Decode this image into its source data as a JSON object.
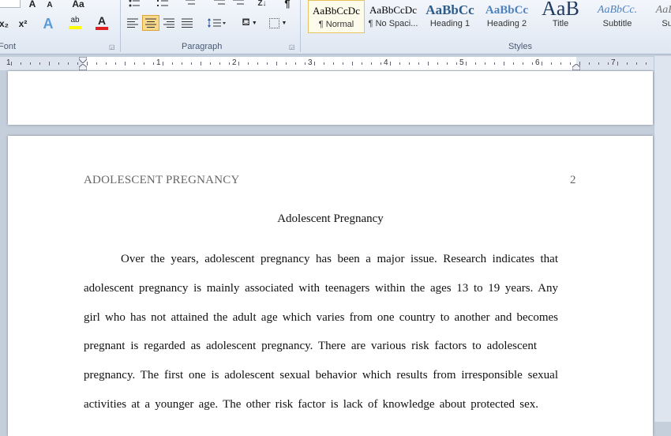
{
  "ribbon": {
    "font_group": {
      "label": "Font",
      "grow_glyph": "A",
      "shrink_glyph": "A",
      "case_glyph": "Aa",
      "subscript": "x₂",
      "superscript": "x²",
      "highlight_glyph": "ab",
      "font_color_glyph": "A",
      "highlight_color": "#ffff00",
      "font_color": "#e02020"
    },
    "paragraph_group": {
      "label": "Paragraph"
    },
    "styles_group": {
      "label": "Styles",
      "items": [
        {
          "preview": "AaBbCcDc",
          "name": "¶ Normal",
          "selected": true
        },
        {
          "preview": "AaBbCcDc",
          "name": "¶ No Spaci..."
        },
        {
          "preview": "AaBbCc",
          "name": "Heading 1"
        },
        {
          "preview": "AaBbCc",
          "name": "Heading 2"
        },
        {
          "preview": "AaB",
          "name": "Title"
        },
        {
          "preview": "AaBbCc.",
          "name": "Subtitle"
        },
        {
          "preview": "AaBbCc",
          "name": "Subtle"
        }
      ]
    }
  },
  "ruler": {
    "numbers": [
      "1",
      "1",
      "2",
      "3",
      "4",
      "5",
      "6",
      "7"
    ]
  },
  "document": {
    "header_title": "ADOLESCENT PREGNANCY",
    "page_number": "2",
    "title": "Adolescent Pregnancy",
    "lines": [
      "Over the years, adolescent pregnancy has been a major issue. Research indicates that",
      "adolescent pregnancy is mainly associated with teenagers within the ages 13 to 19 years. Any",
      "girl who has not attained the adult age which varies from one country to another and becomes",
      "pregnant is regarded as adolescent pregnancy. There are various risk factors to adolescent",
      "pregnancy. The first one is adolescent sexual behavior which results from irresponsible sexual",
      "activities at a younger age. The other risk factor is lack of knowledge about protected sex."
    ]
  }
}
